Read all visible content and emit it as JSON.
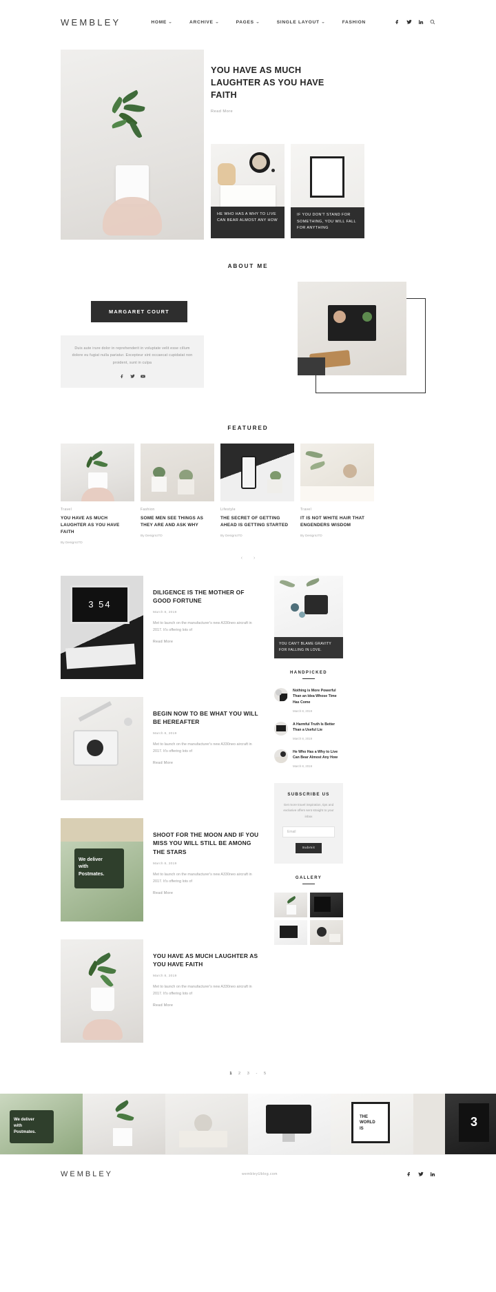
{
  "header": {
    "logo": "WEMBLEY",
    "nav": [
      {
        "label": "HOME",
        "caret": true
      },
      {
        "label": "ARCHIVE",
        "caret": true
      },
      {
        "label": "PAGES",
        "caret": true
      },
      {
        "label": "SINGLE LAYOUT",
        "caret": true
      },
      {
        "label": "FASHION",
        "caret": false
      }
    ],
    "social": [
      "facebook-icon",
      "twitter-icon",
      "linkedin-icon",
      "search-icon"
    ]
  },
  "hero": {
    "title": "YOU HAVE AS MUCH LAUGHTER AS YOU HAVE FAITH",
    "read_more": "Read More",
    "cards": [
      {
        "caption": "HE WHO HAS A WHY TO LIVE CAN BEAR ALMOST ANY HOW"
      },
      {
        "caption": "IF YOU DON'T STAND FOR SOMETHING, YOU WILL FALL FOR ANYTHING"
      }
    ]
  },
  "about": {
    "section_title": "ABOUT ME",
    "name": "MARGARET COURT",
    "bio": "Duis aute irure dolor in reprehenderit in voluptate velit esse cillum dolore eu fugiat nulla pariatur. Excepteur sint occaecat cupidatat non proident, sunt in culpa",
    "social": [
      "facebook-icon",
      "twitter-icon",
      "youtube-icon"
    ]
  },
  "featured": {
    "section_title": "FEATURED",
    "prev_label": "‹",
    "next_label": "›",
    "cards": [
      {
        "category": "Travel",
        "title": "YOU HAVE AS MUCH LAUGHTER AS YOU HAVE FAITH",
        "by_prefix": "By ",
        "author": "DesignUTD"
      },
      {
        "category": "Fashion",
        "title": "SOME MEN SEE THINGS AS THEY ARE AND ASK WHY",
        "by_prefix": "By ",
        "author": "DesignUTD"
      },
      {
        "category": "Lifestyle",
        "title": "THE SECRET OF GETTING AHEAD IS GETTING STARTED",
        "by_prefix": "By ",
        "author": "DesignUTD"
      },
      {
        "category": "Travel",
        "title": "IT IS NOT WHITE HAIR THAT ENGENDERS WISDOM",
        "by_prefix": "By ",
        "author": "DesignUTD"
      }
    ]
  },
  "posts": [
    {
      "title": "DILIGENCE IS THE MOTHER OF GOOD FORTUNE",
      "date": "March 8, 2019",
      "excerpt": "Met to launch on the manufacturer's new A330neo aircraft in 2017. It's offering lots of",
      "read_more": "Read More"
    },
    {
      "title": "BEGIN NOW TO BE WHAT YOU WILL BE HEREAFTER",
      "date": "March 8, 2019",
      "excerpt": "Met to launch on the manufacturer's new A330neo aircraft in 2017. It's offering lots of",
      "read_more": "Read More"
    },
    {
      "title": "SHOOT FOR THE MOON AND IF YOU MISS YOU WILL STILL BE AMONG THE STARS",
      "date": "March 8, 2019",
      "excerpt": "Met to launch on the manufacturer's new A330neo aircraft in 2017. It's offering lots of",
      "read_more": "Read More"
    },
    {
      "title": "YOU HAVE AS MUCH LAUGHTER AS YOU HAVE FAITH",
      "date": "March 8, 2019",
      "excerpt": "Met to launch on the manufacturer's new A330neo aircraft in 2017. It's offering lots of",
      "read_more": "Read More"
    }
  ],
  "sidebar": {
    "feature_caption": "YOU CAN'T BLAME GRAVITY FOR FALLING IN LOVE.",
    "handpicked_title": "HANDPICKED",
    "handpicked": [
      {
        "title": "Nothing is More Powerful Than an Idea Whose Time Has Come",
        "date": "March 8, 2019"
      },
      {
        "title": "A Harmful Truth Is Better Than a Useful Lie",
        "date": "March 8, 2019"
      },
      {
        "title": "He Who Has a Why to Live Can Bear Almost Any How",
        "date": "March 8, 2019"
      }
    ],
    "subscribe": {
      "title": "SUBSCRIBE US",
      "description": "Get more travel inspiration, tips and exclusive offers sent straight to your inbox",
      "placeholder": "Email",
      "button": "Submit"
    },
    "gallery_title": "GALLERY"
  },
  "pagination": {
    "pages": [
      "1",
      "2",
      "3",
      "-",
      "5"
    ],
    "current": "1"
  },
  "footer": {
    "logo": "WEMBLEY",
    "text": "wembleyUblog.com",
    "social": [
      "facebook-icon",
      "twitter-icon",
      "linkedin-icon"
    ]
  },
  "colors": {
    "accent_dark": "#2e2e2e",
    "text": "#232323",
    "muted": "#9a9a9a",
    "panel": "#f2f2f2"
  }
}
